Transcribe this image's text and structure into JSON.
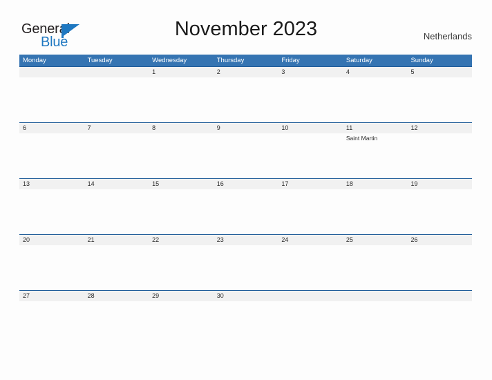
{
  "logo": {
    "word_one": "General",
    "word_two": "Blue",
    "mark": "triangle-flag-icon",
    "color_dark": "#231f20",
    "color_blue": "#1f78c1"
  },
  "header": {
    "title": "November 2023",
    "country": "Netherlands"
  },
  "theme": {
    "header_blue": "#3574b2",
    "rule_blue": "#1f5c99",
    "band_gray": "#f1f1f1",
    "page_background": "#fdfdfd"
  },
  "calendar": {
    "weekday_headers": [
      "Monday",
      "Tuesday",
      "Wednesday",
      "Thursday",
      "Friday",
      "Saturday",
      "Sunday"
    ],
    "weeks": [
      {
        "days": [
          {
            "date": "",
            "events": []
          },
          {
            "date": "",
            "events": []
          },
          {
            "date": "1",
            "events": []
          },
          {
            "date": "2",
            "events": []
          },
          {
            "date": "3",
            "events": []
          },
          {
            "date": "4",
            "events": []
          },
          {
            "date": "5",
            "events": []
          }
        ]
      },
      {
        "days": [
          {
            "date": "6",
            "events": []
          },
          {
            "date": "7",
            "events": []
          },
          {
            "date": "8",
            "events": []
          },
          {
            "date": "9",
            "events": []
          },
          {
            "date": "10",
            "events": []
          },
          {
            "date": "11",
            "events": [
              "Saint Martin"
            ]
          },
          {
            "date": "12",
            "events": []
          }
        ]
      },
      {
        "days": [
          {
            "date": "13",
            "events": []
          },
          {
            "date": "14",
            "events": []
          },
          {
            "date": "15",
            "events": []
          },
          {
            "date": "16",
            "events": []
          },
          {
            "date": "17",
            "events": []
          },
          {
            "date": "18",
            "events": []
          },
          {
            "date": "19",
            "events": []
          }
        ]
      },
      {
        "days": [
          {
            "date": "20",
            "events": []
          },
          {
            "date": "21",
            "events": []
          },
          {
            "date": "22",
            "events": []
          },
          {
            "date": "23",
            "events": []
          },
          {
            "date": "24",
            "events": []
          },
          {
            "date": "25",
            "events": []
          },
          {
            "date": "26",
            "events": []
          }
        ]
      },
      {
        "days": [
          {
            "date": "27",
            "events": []
          },
          {
            "date": "28",
            "events": []
          },
          {
            "date": "29",
            "events": []
          },
          {
            "date": "30",
            "events": []
          },
          {
            "date": "",
            "events": []
          },
          {
            "date": "",
            "events": []
          },
          {
            "date": "",
            "events": []
          }
        ]
      }
    ]
  }
}
